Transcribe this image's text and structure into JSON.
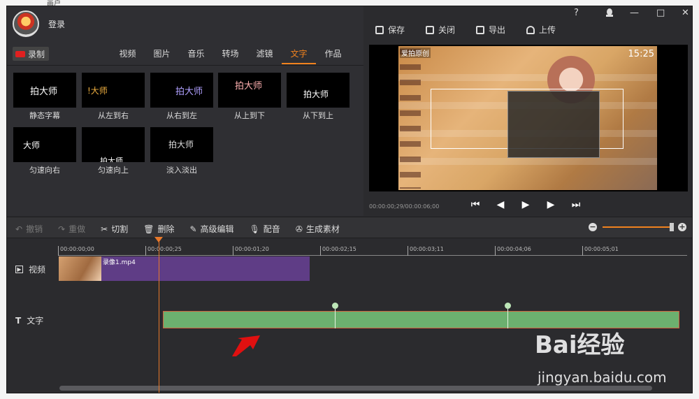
{
  "window": {
    "login_label": "登录",
    "help": "?",
    "minimize": "—",
    "maximize": "□",
    "close": "✕"
  },
  "toolbar_right": {
    "save": "保存",
    "close": "关闭",
    "export": "导出",
    "upload": "上传"
  },
  "record_label": "录制",
  "tabs": [
    "视频",
    "图片",
    "音乐",
    "转场",
    "滤镜",
    "文字",
    "作品"
  ],
  "active_tab": "文字",
  "text_effects": [
    {
      "preview": "拍大师",
      "label": "静态字幕"
    },
    {
      "preview": "!大师",
      "label": "从左到右"
    },
    {
      "preview": "拍大师",
      "label": "从右到左"
    },
    {
      "preview": "拍大师",
      "label": "从上到下"
    },
    {
      "preview": "拍大师",
      "label": "从下到上"
    },
    {
      "preview": "大师",
      "label": "匀速向右"
    },
    {
      "preview": "拍大师",
      "label": "匀速向上"
    },
    {
      "preview": "拍大师",
      "label": "淡入淡出"
    }
  ],
  "preview": {
    "brand": "爱拍原创",
    "clock": "15:25",
    "timecode": "00:00:00;29/00:00:06;00"
  },
  "edit_tools": {
    "undo": "撤销",
    "redo": "重做",
    "cut": "切割",
    "delete": "删除",
    "advanced": "高级编辑",
    "dub": "配音",
    "generate": "生成素材"
  },
  "zoom": {
    "minus": "−",
    "plus": "+",
    "level": 1.0
  },
  "ruler_ticks": [
    "00:00:00;00",
    "00:00:00;25",
    "00:00:01;20",
    "00:00:02;15",
    "00:00:03;11",
    "00:00:04;06",
    "00:00:05;01"
  ],
  "tracks": {
    "video_label": "视频",
    "text_label": "文字",
    "video_clip_name": "录像1.mp4"
  },
  "watermark": {
    "line1": "Bai经验",
    "line2": "jingyan.baidu.com"
  },
  "outside_text": "画户"
}
